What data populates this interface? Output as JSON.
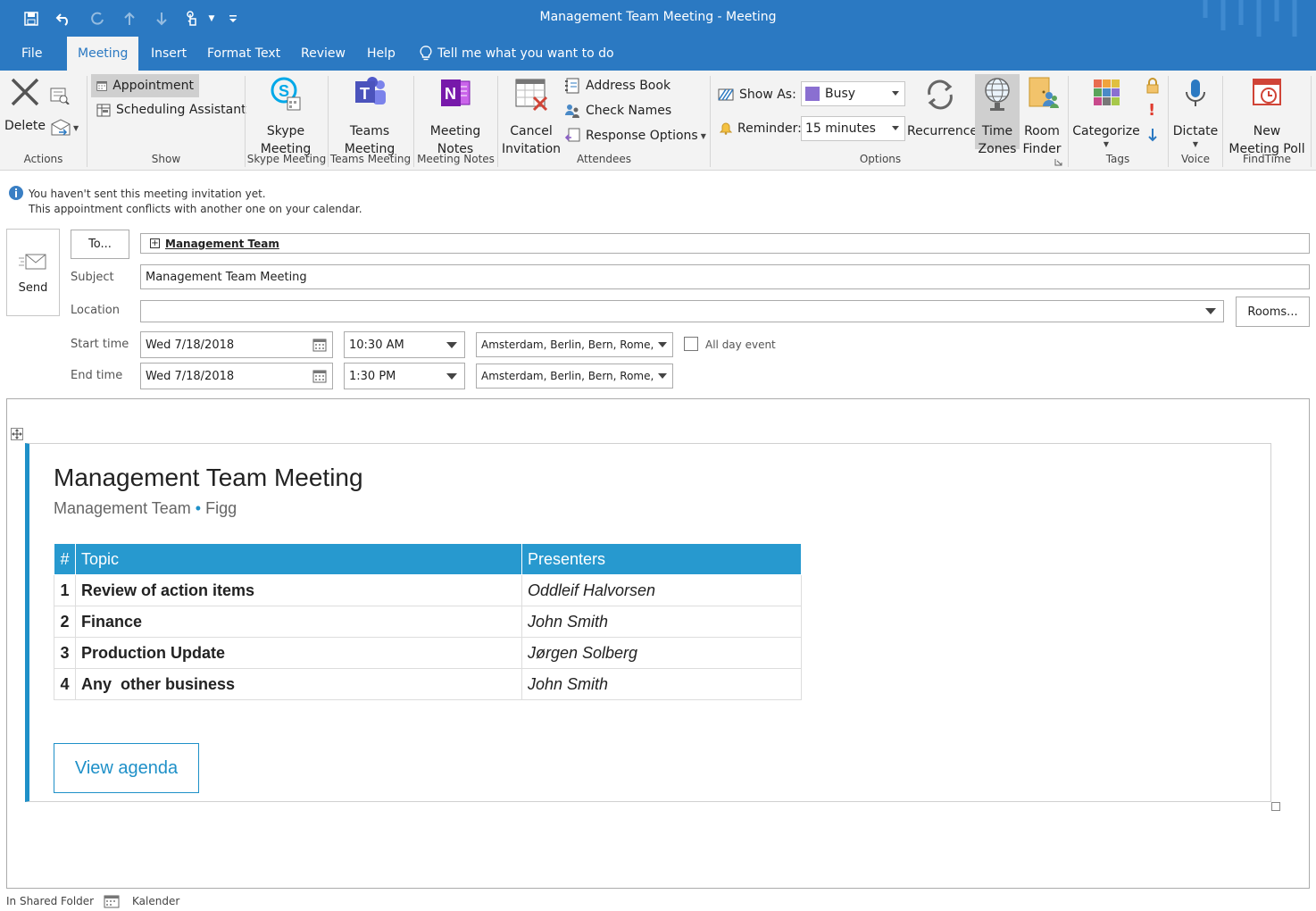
{
  "window": {
    "title": "Management Team Meeting  -  Meeting"
  },
  "tabs": [
    {
      "label": "File"
    },
    {
      "label": "Meeting"
    },
    {
      "label": "Insert"
    },
    {
      "label": "Format Text"
    },
    {
      "label": "Review"
    },
    {
      "label": "Help"
    }
  ],
  "tell_me": "Tell me what you want to do",
  "ribbon": {
    "actions": {
      "delete": "Delete",
      "label": "Actions"
    },
    "show": {
      "appointment": "Appointment",
      "scheduling": "Scheduling Assistant",
      "label": "Show"
    },
    "skype": {
      "line1": "Skype",
      "line2": "Meeting",
      "label": "Skype Meeting"
    },
    "teams": {
      "line1": "Teams",
      "line2": "Meeting",
      "label": "Teams Meeting"
    },
    "notes": {
      "line1": "Meeting",
      "line2": "Notes",
      "label": "Meeting Notes"
    },
    "attendees": {
      "cancel1": "Cancel",
      "cancel2": "Invitation",
      "address_book": "Address Book",
      "check_names": "Check Names",
      "response_options": "Response Options",
      "label": "Attendees"
    },
    "options": {
      "show_as_label": "Show As:",
      "show_as_value": "Busy",
      "reminder_label": "Reminder:",
      "reminder_value": "15 minutes",
      "recurrence": "Recurrence",
      "time1": "Time",
      "time2": "Zones",
      "room1": "Room",
      "room2": "Finder",
      "label": "Options"
    },
    "tags": {
      "categorize": "Categorize",
      "label": "Tags"
    },
    "voice": {
      "dictate": "Dictate",
      "label": "Voice"
    },
    "findtime": {
      "line1": "New",
      "line2": "Meeting Poll",
      "label": "FindTime"
    }
  },
  "info": {
    "line1": "You haven't sent this meeting invitation yet.",
    "line2": "This appointment conflicts with another one on your calendar."
  },
  "form": {
    "send": "Send",
    "to_button": "To...",
    "to_value": "Management Team",
    "subject_label": "Subject",
    "subject_value": "Management Team Meeting",
    "location_label": "Location",
    "location_value": "",
    "rooms_button": "Rooms...",
    "start_label": "Start time",
    "start_date": "Wed 7/18/2018",
    "start_time": "10:30 AM",
    "start_tz": "Amsterdam, Berlin, Bern, Rome, S",
    "all_day": "All day event",
    "end_label": "End time",
    "end_date": "Wed 7/18/2018",
    "end_time": "1:30 PM",
    "end_tz": "Amsterdam, Berlin, Bern, Rome, S"
  },
  "body": {
    "title": "Management Team Meeting",
    "subtitle_left": "Management Team",
    "subtitle_right": "Figg",
    "table_headers": {
      "num": "#",
      "topic": "Topic",
      "presenters": "Presenters"
    },
    "rows": [
      {
        "num": "1",
        "topic": "Review of action items",
        "presenter": "Oddleif Halvorsen"
      },
      {
        "num": "2",
        "topic": "Finance",
        "presenter": "John Smith"
      },
      {
        "num": "3",
        "topic": "Production Update",
        "presenter": "Jørgen Solberg"
      },
      {
        "num": "4",
        "topic": "Any  other business",
        "presenter": "John Smith"
      }
    ],
    "view_agenda": "View agenda"
  },
  "status": {
    "left": "In Shared Folder",
    "right": "Kalender"
  },
  "colors": {
    "accent": "#2b79c2",
    "table_header": "#2799cf",
    "agenda_blue": "#1e90c8",
    "busy": "#8a6fd1"
  }
}
